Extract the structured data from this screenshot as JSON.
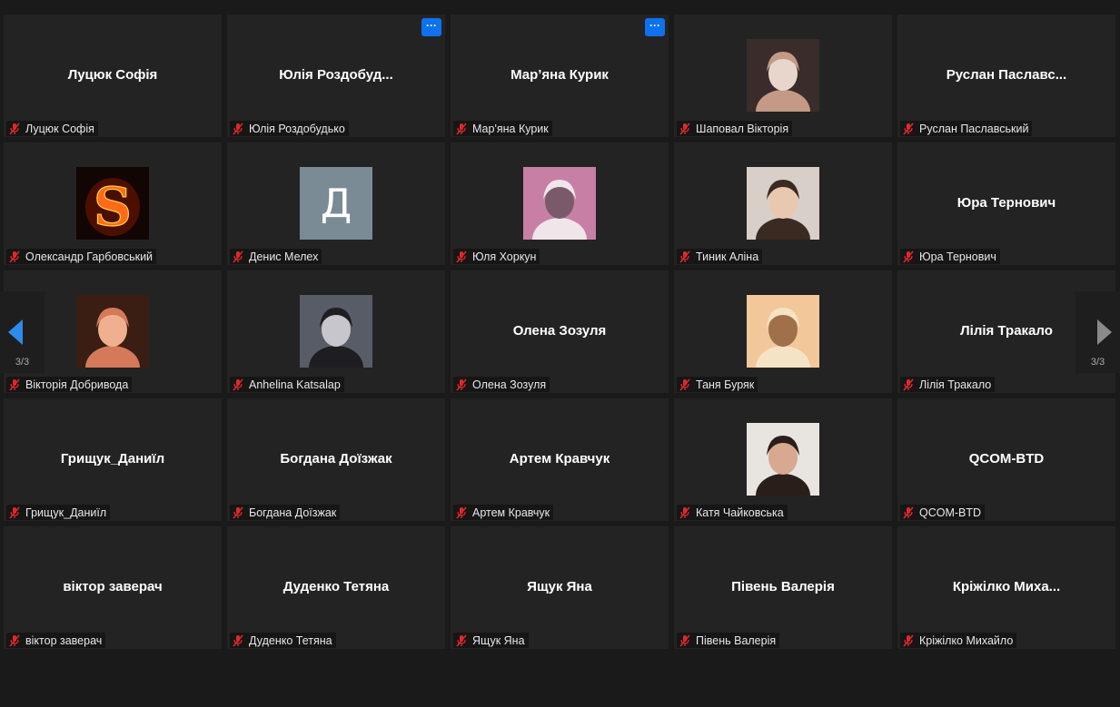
{
  "participants": [
    {
      "display_name": "Луцюк Софія",
      "label": "Луцюк Софія",
      "avatar": null,
      "more_button": false
    },
    {
      "display_name": "Юлія  Роздобуд...",
      "label": "Юлія Роздобудько",
      "avatar": null,
      "more_button": true
    },
    {
      "display_name": "Мар’яна Курик",
      "label": "Мар'яна Курик",
      "avatar": null,
      "more_button": true
    },
    {
      "display_name": "",
      "label": "Шаповал Вікторія",
      "avatar": "photo-icon",
      "more_button": false
    },
    {
      "display_name": "Руслан  Паславс...",
      "label": "Руслан Паславський",
      "avatar": null,
      "more_button": false
    },
    {
      "display_name": "",
      "label": "Олександр Гарбовський",
      "avatar": "fire-s-icon",
      "more_button": false
    },
    {
      "display_name": "",
      "label": "Денис Мелех",
      "avatar": "letter",
      "avatar_letter": "Д",
      "more_button": false
    },
    {
      "display_name": "",
      "label": "Юля Хоркун",
      "avatar": "photo-icon",
      "more_button": false
    },
    {
      "display_name": "",
      "label": "Тиник Аліна",
      "avatar": "photo-icon",
      "more_button": false
    },
    {
      "display_name": "Юра Тернович",
      "label": "Юра Тернович",
      "avatar": null,
      "more_button": false
    },
    {
      "display_name": "",
      "label": "Вікторія Добривода",
      "avatar": "photo-icon",
      "more_button": false
    },
    {
      "display_name": "",
      "label": "Anhelina Katsalap",
      "avatar": "photo-icon",
      "more_button": false
    },
    {
      "display_name": "Олена Зозуля",
      "label": "Олена Зозуля",
      "avatar": null,
      "more_button": false
    },
    {
      "display_name": "",
      "label": "Таня Буряк",
      "avatar": "photo-icon",
      "more_button": false
    },
    {
      "display_name": "Лілія Тракало",
      "label": "Лілія Тракало",
      "avatar": null,
      "more_button": false
    },
    {
      "display_name": "Грищук_Даниїл",
      "label": "Грищук_Даниїл",
      "avatar": null,
      "more_button": false
    },
    {
      "display_name": "Богдана Доїзжак",
      "label": "Богдана Доїзжак",
      "avatar": null,
      "more_button": false
    },
    {
      "display_name": "Артем Кравчук",
      "label": "Артем Кравчук",
      "avatar": null,
      "more_button": false
    },
    {
      "display_name": "",
      "label": "Катя Чайковська",
      "avatar": "photo-icon",
      "more_button": false
    },
    {
      "display_name": "QCOM-BTD",
      "label": "QCOM-BTD",
      "avatar": null,
      "more_button": false
    },
    {
      "display_name": "віктор заверач",
      "label": "віктор заверач",
      "avatar": null,
      "more_button": false
    },
    {
      "display_name": "Дуденко Тетяна",
      "label": "Дуденко Тетяна",
      "avatar": null,
      "more_button": false
    },
    {
      "display_name": "Ящук Яна",
      "label": "Ящук Яна",
      "avatar": null,
      "more_button": false
    },
    {
      "display_name": "Півень Валерія",
      "label": "Півень Валерія",
      "avatar": null,
      "more_button": false
    },
    {
      "display_name": "Кріжілко  Миха...",
      "label": "Кріжілко Михайло",
      "avatar": null,
      "more_button": false
    }
  ],
  "more_button_label": "···",
  "pager": {
    "left_label": "3/3",
    "right_label": "3/3"
  },
  "colors": {
    "tile_bg": "#232323",
    "page_bg": "#1a1a1a",
    "accent": "#0e72ed",
    "muted_mic": "#e02828",
    "left_arrow": "#2d8ceb",
    "right_arrow": "#8a8a8a"
  },
  "photo_palettes": [
    [
      "#3a2c2a",
      "#c49a86",
      "#e8d6cc"
    ],
    [
      "#1a0a05",
      "#ff5a10",
      "#8a1a00"
    ],
    [
      "#c77fa6",
      "#f0e6ea",
      "#7a5a6a"
    ],
    [
      "#d8d0c8",
      "#3a2a22",
      "#e9c8b0"
    ],
    [
      "#3a1e14",
      "#d47a5a",
      "#f0b090"
    ],
    [
      "#585c66",
      "#1e1e22",
      "#c6c6cc"
    ],
    [
      "#f2c89a",
      "#f6e2c4",
      "#a0704a"
    ],
    [
      "#e8e4e0",
      "#2a1e1a",
      "#d8a890"
    ]
  ]
}
